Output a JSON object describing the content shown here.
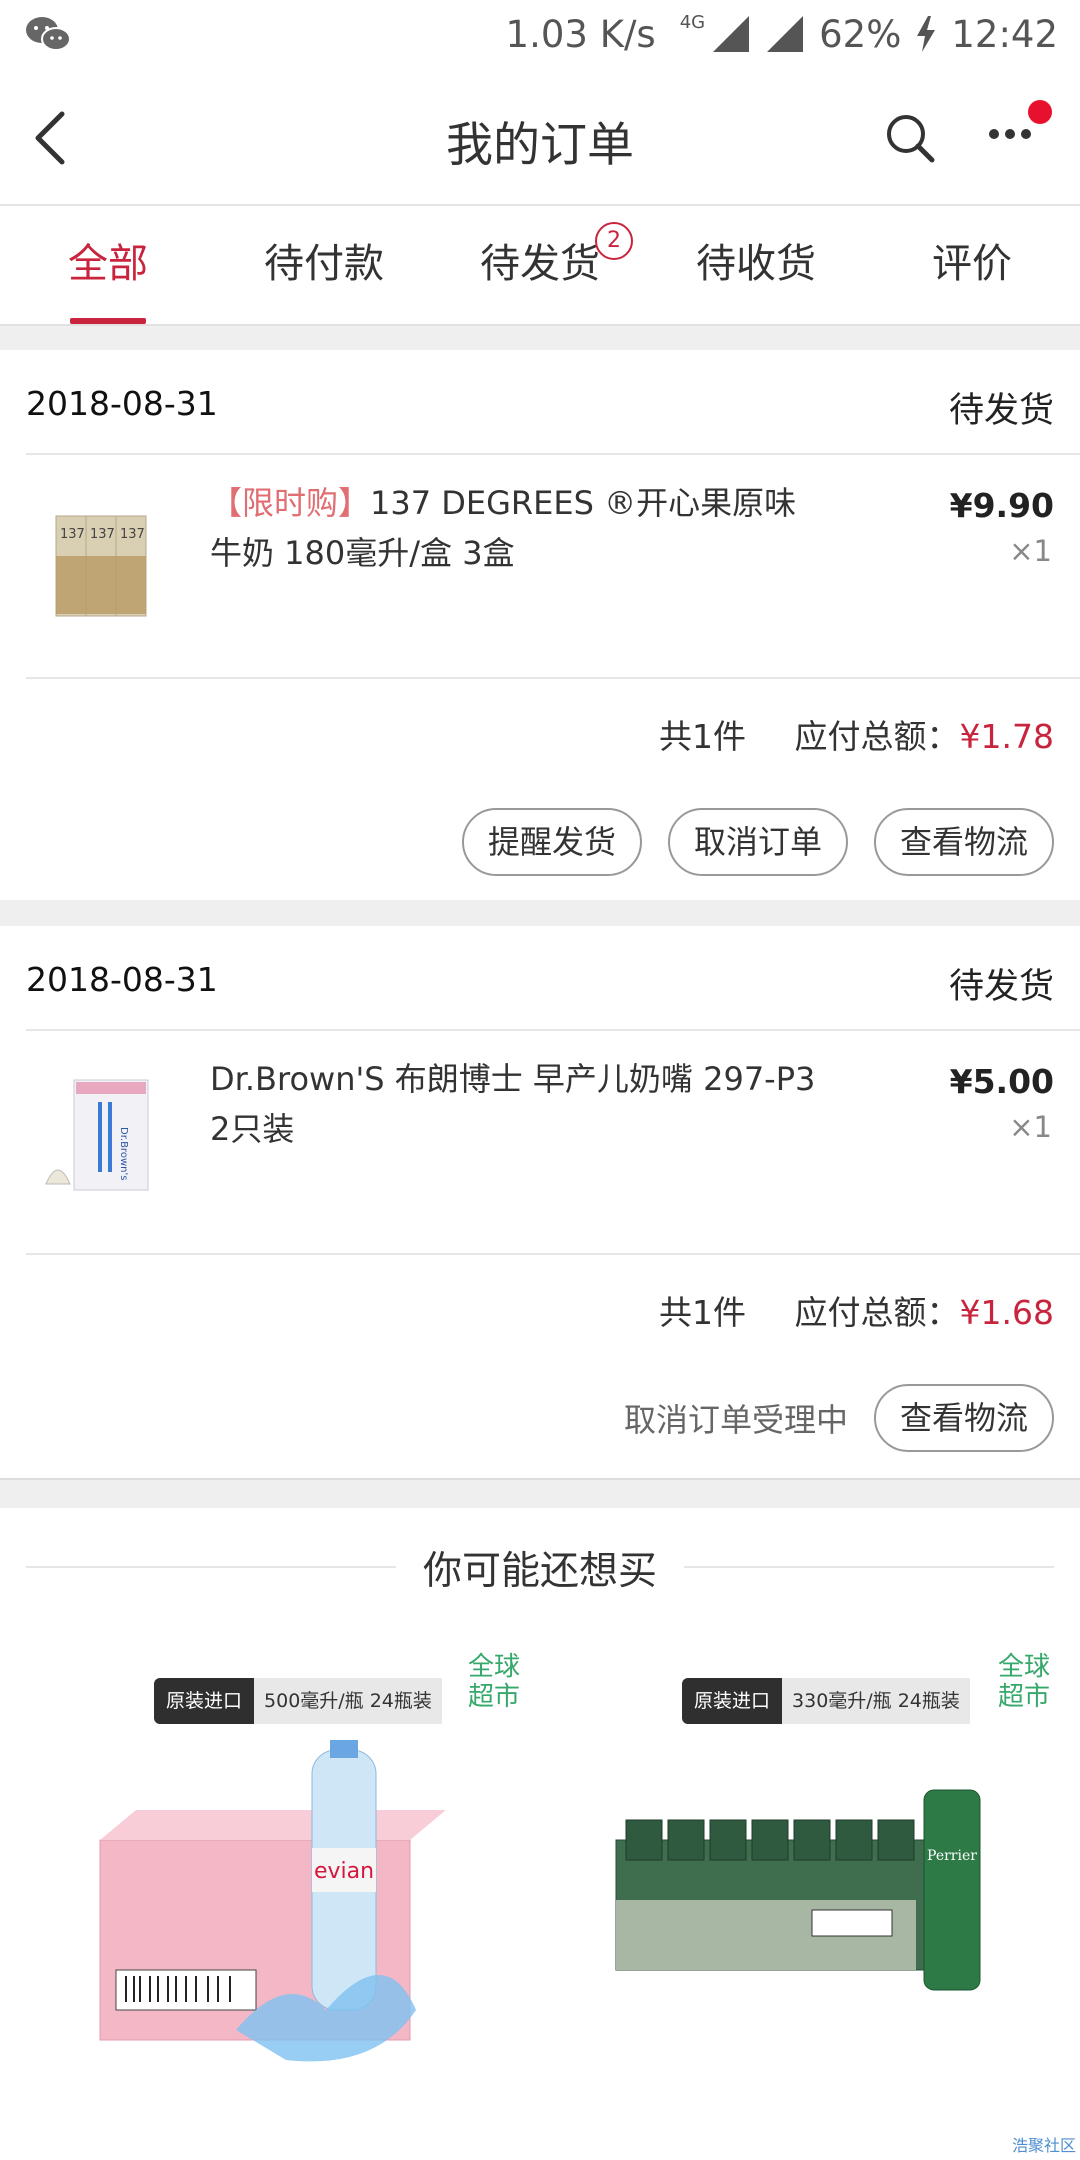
{
  "status": {
    "speed": "1.03 K/s",
    "network": "4G",
    "battery": "62%",
    "time": "12:42"
  },
  "header": {
    "title": "我的订单"
  },
  "tabs": [
    {
      "label": "全部",
      "active": true
    },
    {
      "label": "待付款"
    },
    {
      "label": "待发货",
      "badge": "2"
    },
    {
      "label": "待收货"
    },
    {
      "label": "评价"
    }
  ],
  "orders": [
    {
      "date": "2018-08-31",
      "status": "待发货",
      "tag": "【限时购】",
      "name": "137 DEGREES ®开心果原味牛奶 180毫升/盒 3盒",
      "price": "¥9.90",
      "qty": "×1",
      "count": "共1件",
      "total_label": "应付总额：",
      "total": "¥1.78",
      "buttons": [
        "提醒发货",
        "取消订单",
        "查看物流"
      ]
    },
    {
      "date": "2018-08-31",
      "status": "待发货",
      "name": "Dr.Brown'S 布朗博士 早产儿奶嘴 297-P3 2只装",
      "price": "¥5.00",
      "qty": "×1",
      "count": "共1件",
      "total_label": "应付总额：",
      "total": "¥1.68",
      "pending": "取消订单受理中",
      "buttons": [
        "查看物流"
      ]
    }
  ],
  "recommend": {
    "title": "你可能还想买",
    "items": [
      {
        "pill1": "原装进口",
        "pill2": "500毫升/瓶 24瓶装",
        "badge": "全球\n超市",
        "brand": "evian"
      },
      {
        "pill1": "原装进口",
        "pill2": "330毫升/瓶 24瓶装",
        "badge": "全球\n超市",
        "brand": "Perrier"
      }
    ]
  },
  "watermark": "浩聚社区",
  "colors": {
    "accent": "#c8243d",
    "background": "#efefef",
    "global_green": "#37a86b"
  }
}
